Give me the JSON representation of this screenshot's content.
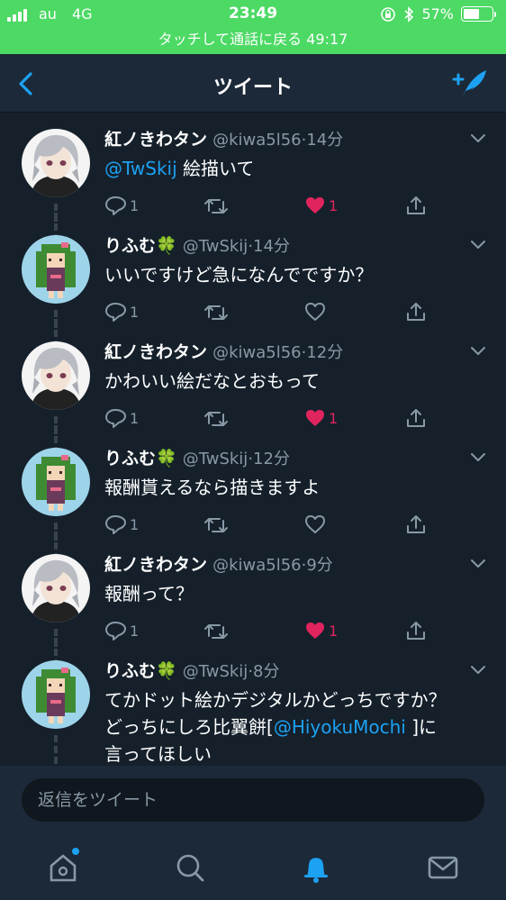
{
  "status_bar": {
    "carrier": "au",
    "network": "4G",
    "time": "23:49",
    "battery": "57%",
    "battery_level": 0.57
  },
  "call_banner": "タッチして通話に戻る 49:17",
  "header": {
    "title": "ツイート"
  },
  "tweets": [
    {
      "name": "紅ノきわタン",
      "handle": "@kiwa5l56",
      "time": "14分",
      "mention": "@TwSkij",
      "text": "絵描いて",
      "reply_count": "1",
      "like_count": "1",
      "liked": true
    },
    {
      "name": "りふむ🍀",
      "handle": "@TwSkij",
      "time": "14分",
      "text": "いいですけど急になんでですか？",
      "reply_count": "1",
      "like_count": "",
      "liked": false
    },
    {
      "name": "紅ノきわタン",
      "handle": "@kiwa5l56",
      "time": "12分",
      "text": "かわいい絵だなとおもって",
      "reply_count": "1",
      "like_count": "1",
      "liked": true
    },
    {
      "name": "りふむ🍀",
      "handle": "@TwSkij",
      "time": "12分",
      "text": "報酬貰えるなら描きますよ",
      "reply_count": "1",
      "like_count": "",
      "liked": false
    },
    {
      "name": "紅ノきわタン",
      "handle": "@kiwa5l56",
      "time": "9分",
      "text": "報酬って？",
      "reply_count": "1",
      "like_count": "1",
      "liked": true
    },
    {
      "name": "りふむ🍀",
      "handle": "@TwSkij",
      "time": "8分",
      "text_line1": "てかドット絵かデジタルかどっちですか？",
      "text_line2_pre": "どっちにしろ比翼餅[",
      "mention": "@HiyokuMochi",
      "text_line2_post": " ]に",
      "text_line3": "言ってほしい"
    }
  ],
  "reply": {
    "placeholder": "返信をツイート"
  },
  "tabs": [
    "home-icon",
    "search-icon",
    "notifications-icon",
    "messages-icon"
  ],
  "colors": {
    "accent": "#1da1f2",
    "like": "#e0245e",
    "background": "#15202b",
    "bar": "#1c2938",
    "status": "#4cd964"
  }
}
